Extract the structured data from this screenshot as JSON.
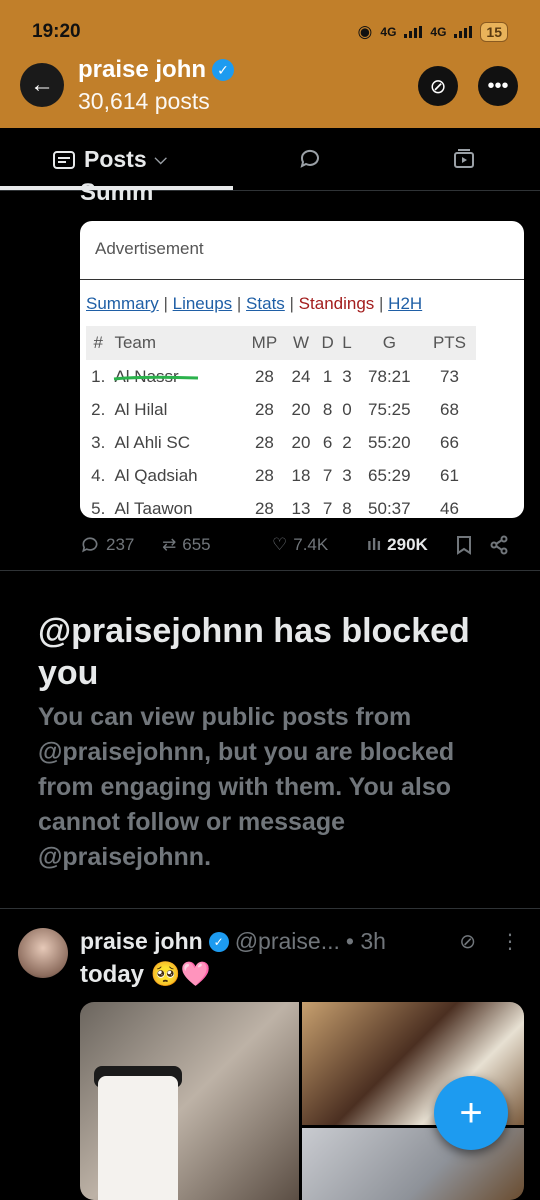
{
  "status_bar": {
    "time": "19:20",
    "net1": "4G",
    "net2": "4G",
    "battery": "15"
  },
  "header": {
    "name": "praise john",
    "posts_count": "30,614 posts"
  },
  "tabs": {
    "posts_label": "Posts"
  },
  "prev_post": {
    "cut_text": "Summ"
  },
  "ad": {
    "label": "Advertisement",
    "links": {
      "summary": "Summary",
      "lineups": "Lineups",
      "stats": "Stats",
      "standings": "Standings",
      "h2h": "H2H"
    },
    "headers": [
      "#",
      "Team",
      "MP",
      "W",
      "D",
      "L",
      "G",
      "PTS"
    ],
    "rows": [
      [
        "1.",
        "Al Nassr",
        "28",
        "24",
        "1",
        "3",
        "78:21",
        "73"
      ],
      [
        "2.",
        "Al Hilal",
        "28",
        "20",
        "8",
        "0",
        "75:25",
        "68"
      ],
      [
        "3.",
        "Al Ahli SC",
        "28",
        "20",
        "6",
        "2",
        "55:20",
        "66"
      ],
      [
        "4.",
        "Al Qadsiah",
        "28",
        "18",
        "7",
        "3",
        "65:29",
        "61"
      ],
      [
        "5.",
        "Al Taawon",
        "28",
        "13",
        "7",
        "8",
        "50:37",
        "46"
      ]
    ]
  },
  "actions": {
    "replies": "237",
    "reposts": "655",
    "likes": "7.4K",
    "views": "290K"
  },
  "blocked": {
    "title": "@praisejohnn has blocked you",
    "body": "You can view public posts from @praisejohnn, but you are blocked from engaging with them. You also cannot follow or message @praisejohnn."
  },
  "post": {
    "name": "praise john",
    "handle": "@praise...",
    "time": "• 3h",
    "text": "today 🥺🩷"
  },
  "colors": {
    "header_bg": "#c17f2a",
    "accent": "#1d9bf0",
    "standings_active": "#a31d1d"
  }
}
